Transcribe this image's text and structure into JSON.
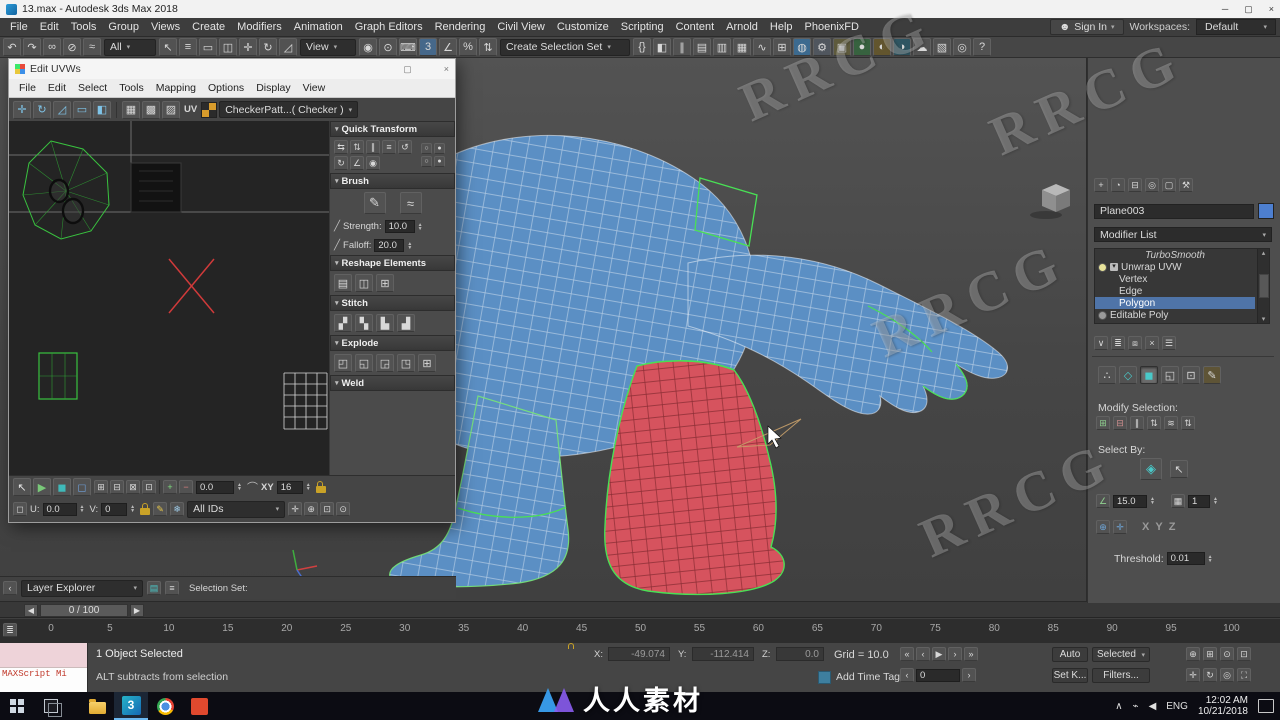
{
  "window": {
    "title": "13.max - Autodesk 3ds Max 2018"
  },
  "menubar": {
    "items": [
      "File",
      "Edit",
      "Tools",
      "Group",
      "Views",
      "Create",
      "Modifiers",
      "Animation",
      "Graph Editors",
      "Rendering",
      "Civil View",
      "Customize",
      "Scripting",
      "Content",
      "Arnold",
      "Help",
      "PhoenixFD"
    ],
    "sign_in": "Sign In",
    "workspaces_label": "Workspaces:",
    "workspaces_value": "Default"
  },
  "toolbar": {
    "icons_a": [
      {
        "name": "undo-icon",
        "glyph": "↶"
      },
      {
        "name": "redo-icon",
        "glyph": "↷"
      },
      {
        "name": "select-and-link-icon",
        "glyph": "∞"
      },
      {
        "name": "unlink-selection-icon",
        "glyph": "⊘"
      },
      {
        "name": "bind-to-space-warp-icon",
        "glyph": "≈"
      }
    ],
    "filter_value": "All",
    "icons_b": [
      {
        "name": "select-object-icon",
        "glyph": "↖"
      },
      {
        "name": "select-by-name-icon",
        "glyph": "≡"
      },
      {
        "name": "rectangular-selection-region-icon",
        "glyph": "▭"
      },
      {
        "name": "window-crossing-icon",
        "glyph": "◫"
      },
      {
        "name": "select-and-move-icon",
        "glyph": "✛"
      },
      {
        "name": "select-and-rotate-icon",
        "glyph": "↻"
      },
      {
        "name": "select-and-scale-icon",
        "glyph": "◿"
      }
    ],
    "ref_coord_value": "View",
    "icons_c": [
      {
        "name": "use-pivot-point-center-icon",
        "glyph": "◉"
      },
      {
        "name": "select-and-manipulate-icon",
        "glyph": "⊙"
      },
      {
        "name": "keyboard-shortcut-override-icon",
        "glyph": "⌨"
      },
      {
        "name": "snaps-toggle-icon",
        "glyph": "3",
        "tint": "#46688a"
      },
      {
        "name": "angle-snap-icon",
        "glyph": "∠"
      },
      {
        "name": "percent-snap-icon",
        "glyph": "%"
      },
      {
        "name": "spinner-snap-icon",
        "glyph": "⇅"
      }
    ],
    "selection_set_placeholder": "Create Selection Set",
    "icons_d": [
      {
        "name": "edit-named-selection-sets-icon",
        "glyph": "{}"
      },
      {
        "name": "mirror-icon",
        "glyph": "◧"
      },
      {
        "name": "align-icon",
        "glyph": "∥"
      },
      {
        "name": "toggle-scene-explorer-icon",
        "glyph": "▤"
      },
      {
        "name": "toggle-layer-explorer-icon",
        "glyph": "▥"
      },
      {
        "name": "toggle-ribbon-icon",
        "glyph": "▦"
      },
      {
        "name": "curve-editor-icon",
        "glyph": "∿"
      },
      {
        "name": "schematic-view-icon",
        "glyph": "⊞"
      },
      {
        "name": "material-editor-icon",
        "glyph": "◍",
        "tint": "#3c6a8f"
      },
      {
        "name": "render-setup-icon",
        "glyph": "⚙",
        "tint": "#50565e"
      },
      {
        "name": "rendered-frame-window-icon",
        "glyph": "▣",
        "tint": "#5e5a3c"
      },
      {
        "name": "render-production-icon",
        "glyph": "●",
        "tint": "#37623f"
      },
      {
        "name": "render-iterative-icon",
        "glyph": "◐",
        "tint": "#62552e"
      },
      {
        "name": "activeshade-icon",
        "glyph": "◑",
        "tint": "#2e5562"
      },
      {
        "name": "render-in-cloud-icon",
        "glyph": "☁"
      },
      {
        "name": "open-autodesk-app-icon",
        "glyph": "▧"
      },
      {
        "name": "arnold-render-icon",
        "glyph": "◎"
      },
      {
        "name": "help-search-icon",
        "glyph": "?"
      }
    ]
  },
  "uvw": {
    "title": "Edit UVWs",
    "menu": [
      "File",
      "Edit",
      "Select",
      "Tools",
      "Mapping",
      "Options",
      "Display",
      "View"
    ],
    "toolbar_icons": [
      {
        "name": "uv-move-icon",
        "glyph": "✛",
        "fg": "#7fc4e8"
      },
      {
        "name": "uv-rotate-icon",
        "glyph": "↻",
        "fg": "#7fc4e8"
      },
      {
        "name": "uv-scale-icon",
        "glyph": "◿",
        "fg": "#7fc4e8"
      },
      {
        "name": "uv-freeform-icon",
        "glyph": "▭",
        "fg": "#7fc4e8"
      },
      {
        "name": "uv-mirror-icon",
        "glyph": "◧",
        "fg": "#7fc4e8"
      }
    ],
    "pattern_icons": [
      {
        "name": "show-map-icon",
        "glyph": "▦"
      },
      {
        "name": "snap-grid-icon",
        "glyph": "▩"
      },
      {
        "name": "tile-pattern-icon",
        "glyph": "▨"
      }
    ],
    "uv_label": "UV",
    "checker_value": "CheckerPatt...( Checker )",
    "rollouts": {
      "quick_transform": "Quick Transform",
      "brush": "Brush",
      "strength_label": "Strength:",
      "strength_value": "10.0",
      "falloff_label": "Falloff:",
      "falloff_value": "20.0",
      "reshape": "Reshape Elements",
      "stitch": "Stitch",
      "explode": "Explode",
      "weld_label": "Weld"
    },
    "qt_icons": [
      {
        "name": "qt-align-horizontal-icon",
        "glyph": "⇆"
      },
      {
        "name": "qt-align-vertical-icon",
        "glyph": "⇅"
      },
      {
        "name": "qt-space-horizontal-icon",
        "glyph": "∥"
      },
      {
        "name": "qt-linear-align-icon",
        "glyph": "≡"
      },
      {
        "name": "qt-rotate-ccw-icon",
        "glyph": "↺"
      },
      {
        "name": "qt-rotate-cw-icon",
        "glyph": "↻"
      },
      {
        "name": "qt-align-to-edge-icon",
        "glyph": "∠"
      },
      {
        "name": "qt-snap-center-icon",
        "glyph": "◉"
      }
    ],
    "qt_minis": [
      {
        "name": "qt-option-1-icon",
        "glyph": "○"
      },
      {
        "name": "qt-option-2-icon",
        "glyph": "●"
      },
      {
        "name": "qt-option-3-icon",
        "glyph": "○"
      },
      {
        "name": "qt-option-4-icon",
        "glyph": "●"
      }
    ],
    "brush_icons": [
      {
        "name": "paint-brush-icon",
        "glyph": "✎"
      },
      {
        "name": "relax-brush-icon",
        "glyph": "≈"
      }
    ],
    "reshape_icons": [
      {
        "name": "reshape-grid-icon",
        "glyph": "▤"
      },
      {
        "name": "reshape-box-icon",
        "glyph": "◫"
      },
      {
        "name": "reshape-planar-icon",
        "glyph": "⊞"
      }
    ],
    "stitch_icons": [
      {
        "name": "stitch-custom-icon",
        "glyph": "▞"
      },
      {
        "name": "stitch-average-icon",
        "glyph": "▚"
      },
      {
        "name": "stitch-source-icon",
        "glyph": "▙"
      },
      {
        "name": "stitch-target-icon",
        "glyph": "▟"
      }
    ],
    "explode_icons": [
      {
        "name": "explode-flatten-icon",
        "glyph": "◰"
      },
      {
        "name": "explode-by-edge-icon",
        "glyph": "◱"
      },
      {
        "name": "explode-by-face-icon",
        "glyph": "◲"
      },
      {
        "name": "explode-by-smoothing-icon",
        "glyph": "◳"
      },
      {
        "name": "explode-by-material-icon",
        "glyph": "⊞"
      }
    ],
    "foot_icons_row1a": [
      {
        "name": "uv-select-arrow-icon",
        "glyph": "↖",
        "fg": "#e6e6e6"
      },
      {
        "name": "uv-paint-region-icon",
        "glyph": "▶",
        "fg": "#79c879"
      },
      {
        "name": "uv-fill-icon",
        "glyph": "◼",
        "fg": "#3fb9b9"
      },
      {
        "name": "uv-cube-icon",
        "glyph": "◻",
        "fg": "#6f9fd8"
      }
    ],
    "foot_icons_row1b": [
      {
        "name": "uv-grid-1-icon",
        "glyph": "⊞"
      },
      {
        "name": "uv-grid-2-icon",
        "glyph": "⊟"
      },
      {
        "name": "uv-grid-3-icon",
        "glyph": "⊠"
      },
      {
        "name": "uv-grid-4-icon",
        "glyph": "⊡"
      }
    ],
    "foot_plus_minus": [
      {
        "name": "uv-add-icon",
        "glyph": "+",
        "fg": "#7fe07f"
      },
      {
        "name": "uv-subtract-icon",
        "glyph": "−",
        "fg": "#e07f7f"
      }
    ],
    "foot_nav_icons": [
      {
        "name": "uv-pan-icon",
        "glyph": "✛"
      },
      {
        "name": "uv-zoom-icon",
        "glyph": "⊕"
      },
      {
        "name": "uv-zoom-region-icon",
        "glyph": "⊡"
      },
      {
        "name": "uv-zoom-extents-icon",
        "glyph": "⊙"
      }
    ],
    "bottom": {
      "rot_value": "0.0",
      "xy_label": "XY",
      "grid_value": "16",
      "u_label": "U:",
      "u_value": "0.0",
      "v_label": "V:",
      "v_value": "0",
      "all_ids_value": "All IDs"
    }
  },
  "command_panel": {
    "tabs": [
      {
        "name": "create-tab-icon",
        "glyph": "+"
      },
      {
        "name": "modify-tab-icon",
        "glyph": "◔"
      },
      {
        "name": "hierarchy-tab-icon",
        "glyph": "⊟"
      },
      {
        "name": "motion-tab-icon",
        "glyph": "◎"
      },
      {
        "name": "display-tab-icon",
        "glyph": "▢"
      },
      {
        "name": "utilities-tab-icon",
        "glyph": "⚒"
      }
    ],
    "object_name": "Plane003",
    "modifier_list_label": "Modifier List",
    "stack": [
      {
        "label": "TurboSmooth"
      },
      {
        "label": "Unwrap UVW"
      },
      {
        "label": "Vertex"
      },
      {
        "label": "Edge"
      },
      {
        "label": "Polygon"
      },
      {
        "label": "Editable Poly"
      }
    ],
    "stack_buttons": [
      {
        "name": "pin-stack-icon",
        "glyph": "∨"
      },
      {
        "name": "show-end-result-icon",
        "glyph": "≣"
      },
      {
        "name": "make-unique-icon",
        "glyph": "⧈"
      },
      {
        "name": "remove-modifier-icon",
        "glyph": "×"
      },
      {
        "name": "configure-modifier-sets-icon",
        "glyph": "☰"
      }
    ],
    "sel_icons": [
      {
        "name": "uvw-vertex-select-icon",
        "glyph": "∴",
        "fg": "#d8d8d8"
      },
      {
        "name": "uvw-edge-select-icon",
        "glyph": "◇",
        "fg": "#49c8c8"
      },
      {
        "name": "uvw-polygon-select-icon",
        "glyph": "◼",
        "fg": "#49c8c8",
        "cls": "pressed"
      },
      {
        "name": "uvw-element-icon",
        "glyph": "◱"
      },
      {
        "name": "uvw-select-element-icon",
        "glyph": "⊡"
      },
      {
        "name": "uvw-paint-select-icon",
        "glyph": "✎",
        "tint": "#5e5436"
      }
    ],
    "modify_selection_label": "Modify Selection:",
    "modify_icons": [
      {
        "name": "grow-selection-icon",
        "glyph": "⊞",
        "fg": "#8fd08f"
      },
      {
        "name": "shrink-selection-icon",
        "glyph": "⊟",
        "fg": "#d08f8f"
      },
      {
        "name": "select-ring-icon",
        "glyph": "∥"
      },
      {
        "name": "ring-spinner-icon",
        "glyph": "⇅"
      },
      {
        "name": "select-loop-icon",
        "glyph": "≋"
      },
      {
        "name": "loop-spinner-icon",
        "glyph": "⇅"
      }
    ],
    "select_by_label": "Select By:",
    "angle_value": "15.0",
    "planar_value": "1",
    "axes": [
      "X",
      "Y",
      "Z"
    ],
    "threshold_label": "Threshold:",
    "threshold_value": "0.01"
  },
  "bottom_bar": {
    "layer_explorer": "Layer Explorer",
    "selection_set_label": "Selection Set:",
    "time_display": "0 / 100",
    "ticks": [
      "0",
      "5",
      "10",
      "15",
      "20",
      "25",
      "30",
      "35",
      "40",
      "45",
      "50",
      "55",
      "60",
      "65",
      "70",
      "75",
      "80",
      "85",
      "90",
      "95",
      "100"
    ]
  },
  "status_bar": {
    "maxscript": "MAXScript Mi",
    "line1": "1 Object Selected",
    "line2": "ALT subtracts from selection",
    "x_label": "X:",
    "x_value": "-49.074",
    "y_label": "Y:",
    "y_value": "-112.414",
    "z_label": "Z:",
    "z_value": "0.0",
    "grid": "Grid = 10.0",
    "add_time_tag": "Add Time Tag",
    "playback": [
      {
        "name": "go-to-start-button",
        "glyph": "«"
      },
      {
        "name": "previous-frame-button",
        "glyph": "‹"
      },
      {
        "name": "play-button",
        "glyph": "▶"
      },
      {
        "name": "next-frame-button",
        "glyph": "›"
      },
      {
        "name": "go-to-end-button",
        "glyph": "»"
      }
    ],
    "frame_value": "0",
    "auto": "Auto",
    "selected": "Selected",
    "set_key": "Set K...",
    "filters": "Filters...",
    "nav_icons_row1": [
      {
        "name": "zoom-icon",
        "glyph": "⊕"
      },
      {
        "name": "zoom-all-icon",
        "glyph": "⊞"
      },
      {
        "name": "zoom-extents-icon",
        "glyph": "⊙"
      },
      {
        "name": "zoom-region-icon",
        "glyph": "⊡"
      }
    ],
    "nav_icons_row2": [
      {
        "name": "pan-icon",
        "glyph": "✛"
      },
      {
        "name": "orbit-icon",
        "glyph": "↻"
      },
      {
        "name": "isolate-selection-icon",
        "glyph": "◎"
      },
      {
        "name": "maximize-viewport-icon",
        "glyph": "⛶"
      }
    ]
  },
  "taskbar": {
    "lang": "ENG",
    "time": "12:02 AM",
    "date": "10/21/2018"
  },
  "watermarks": {
    "rrcg": "RRCG",
    "brand": "人人素材"
  }
}
